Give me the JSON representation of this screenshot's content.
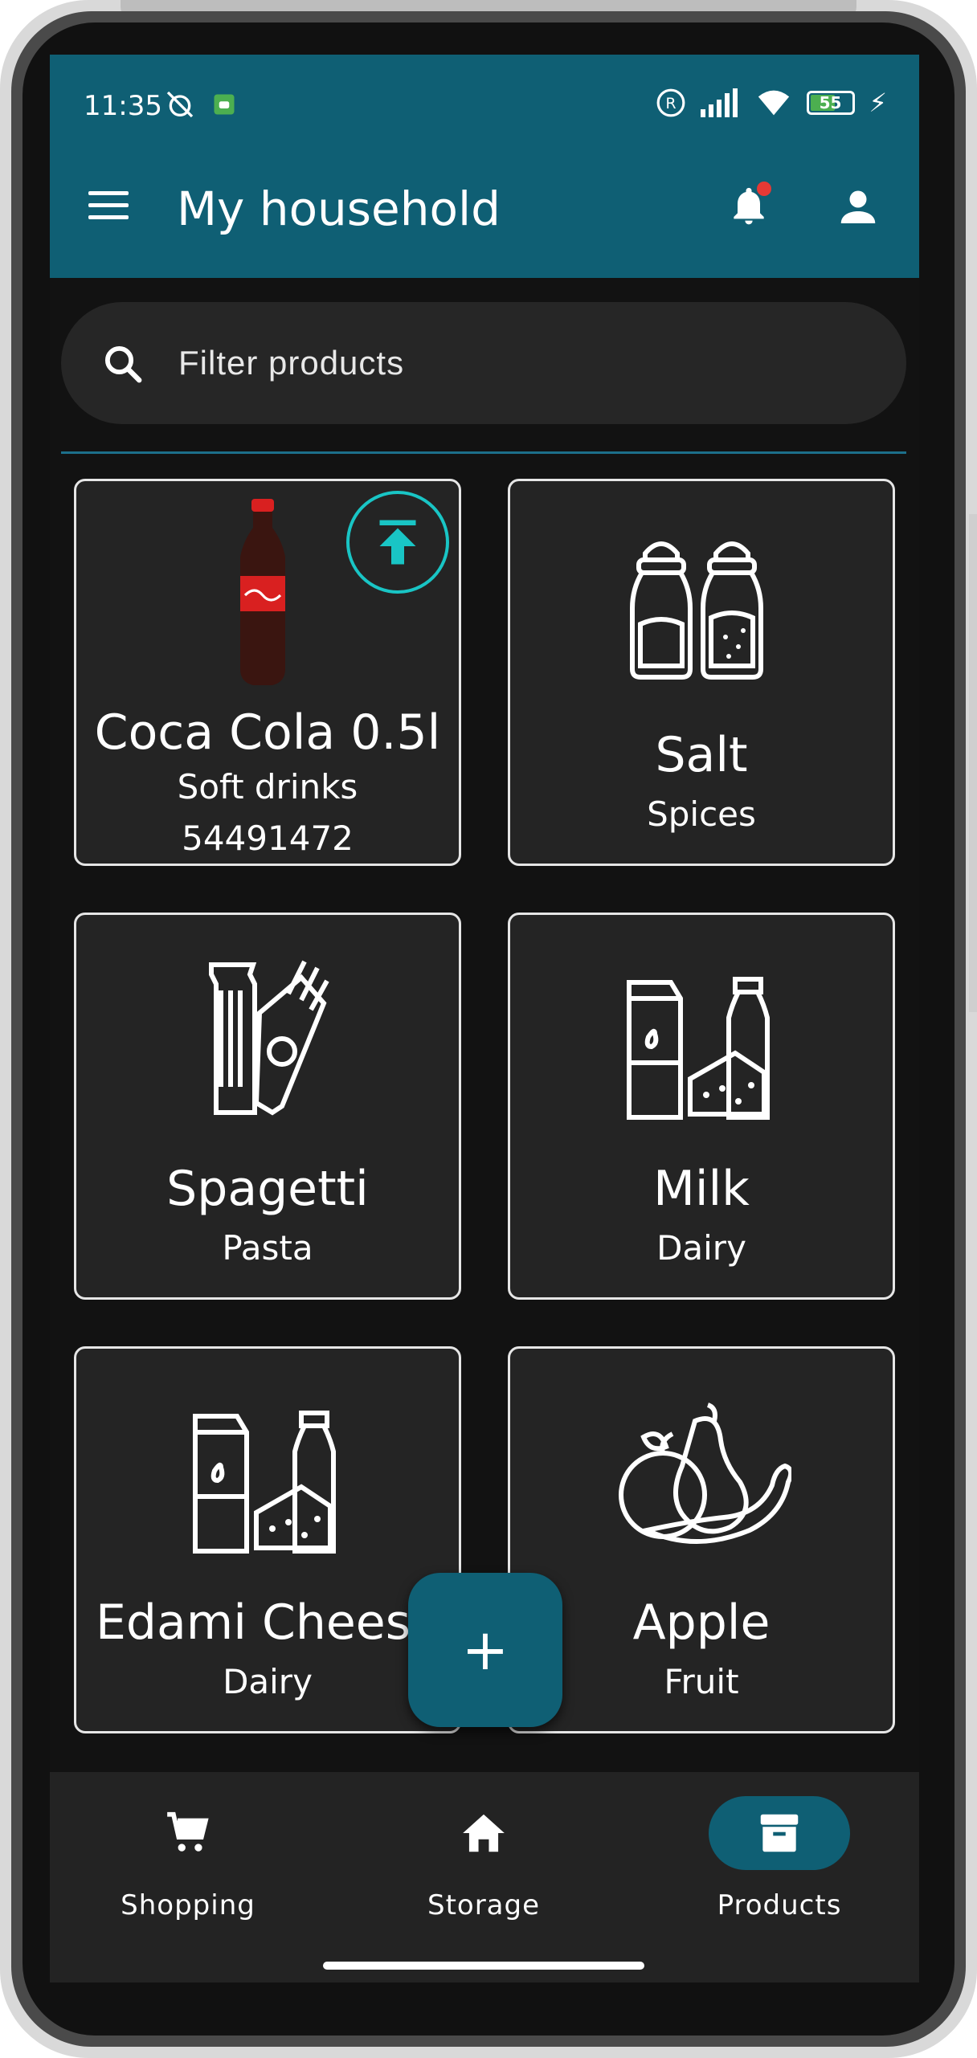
{
  "status_bar": {
    "time": "11:35",
    "battery_level": "55"
  },
  "app_bar": {
    "title": "My household"
  },
  "search": {
    "placeholder": "Filter products"
  },
  "products": [
    {
      "name": "Coca Cola 0.5l",
      "category": "Soft drinks",
      "barcode": "54491472",
      "icon": "coca-cola-bottle-photo"
    },
    {
      "name": "Salt",
      "category": "Spices",
      "icon": "salt-pepper-shakers-icon"
    },
    {
      "name": "Spagetti",
      "category": "Pasta",
      "icon": "pasta-package-icon"
    },
    {
      "name": "Milk",
      "category": "Dairy",
      "icon": "dairy-products-icon"
    },
    {
      "name": "Edami Chees",
      "category": "Dairy",
      "icon": "dairy-products-icon"
    },
    {
      "name": "Apple",
      "category": "Fruit",
      "icon": "fruit-icon"
    }
  ],
  "fab": {
    "label": "+"
  },
  "bottom_nav": {
    "items": [
      {
        "label": "Shopping",
        "icon": "cart-icon"
      },
      {
        "label": "Storage",
        "icon": "home-icon"
      },
      {
        "label": "Products",
        "icon": "archive-box-icon",
        "active": true
      }
    ]
  },
  "colors": {
    "app_bar": "#0f5f74",
    "background": "#121212",
    "card": "#242424",
    "accent": "#19c5c5",
    "notification_dot": "#e53935"
  }
}
